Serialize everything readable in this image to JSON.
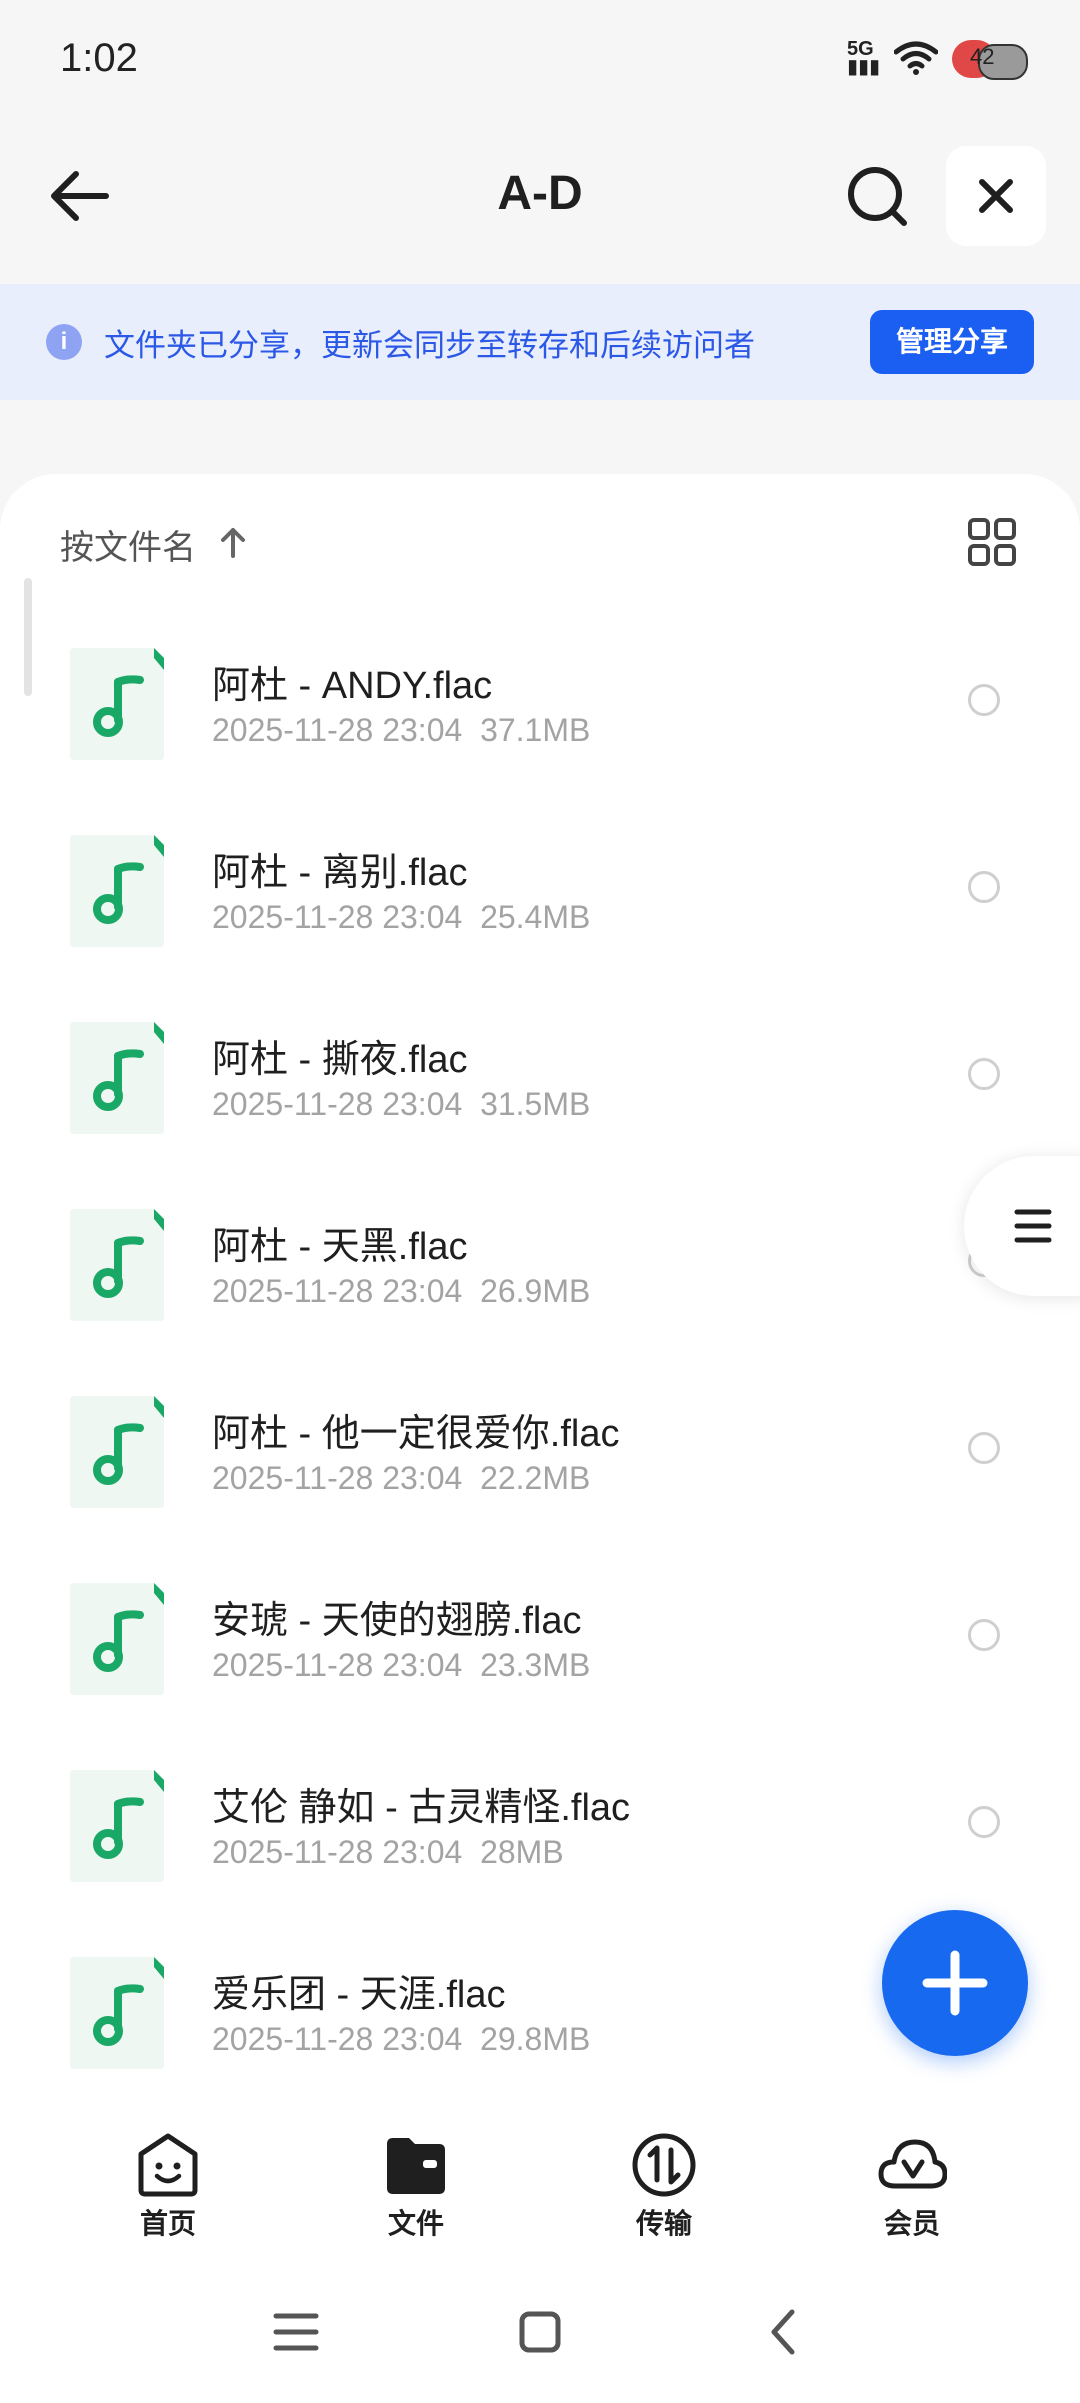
{
  "status": {
    "time": "1:02",
    "signal": "5G",
    "battery": "42"
  },
  "nav": {
    "title": "A-D"
  },
  "banner": {
    "text": "文件夹已分享，更新会同步至转存和后续访问者",
    "button": "管理分享"
  },
  "list": {
    "sort_label": "按文件名",
    "files": [
      {
        "name": "阿杜 - ANDY.flac",
        "date": "2025-11-28 23:04",
        "size": "37.1MB"
      },
      {
        "name": "阿杜 - 离别.flac",
        "date": "2025-11-28 23:04",
        "size": "25.4MB"
      },
      {
        "name": "阿杜 - 撕夜.flac",
        "date": "2025-11-28 23:04",
        "size": "31.5MB"
      },
      {
        "name": "阿杜 - 天黑.flac",
        "date": "2025-11-28 23:04",
        "size": "26.9MB"
      },
      {
        "name": "阿杜 - 他一定很爱你.flac",
        "date": "2025-11-28 23:04",
        "size": "22.2MB"
      },
      {
        "name": "安琥 - 天使的翅膀.flac",
        "date": "2025-11-28 23:04",
        "size": "23.3MB"
      },
      {
        "name": "艾伦 静如 - 古灵精怪.flac",
        "date": "2025-11-28 23:04",
        "size": "28MB"
      },
      {
        "name": "爱乐团 - 天涯.flac",
        "date": "2025-11-28 23:04",
        "size": "29.8MB"
      }
    ]
  },
  "tabs": [
    {
      "label": "首页",
      "icon": "smile-face-icon"
    },
    {
      "label": "文件",
      "icon": "folder-icon"
    },
    {
      "label": "传输",
      "icon": "transfer-icon"
    },
    {
      "label": "会员",
      "icon": "cloud-vip-icon"
    }
  ],
  "colors": {
    "accent": "#1b5ff2",
    "banner_bg": "#e9eefd",
    "banner_text": "#2b58e6",
    "music_green": "#1aa866"
  }
}
